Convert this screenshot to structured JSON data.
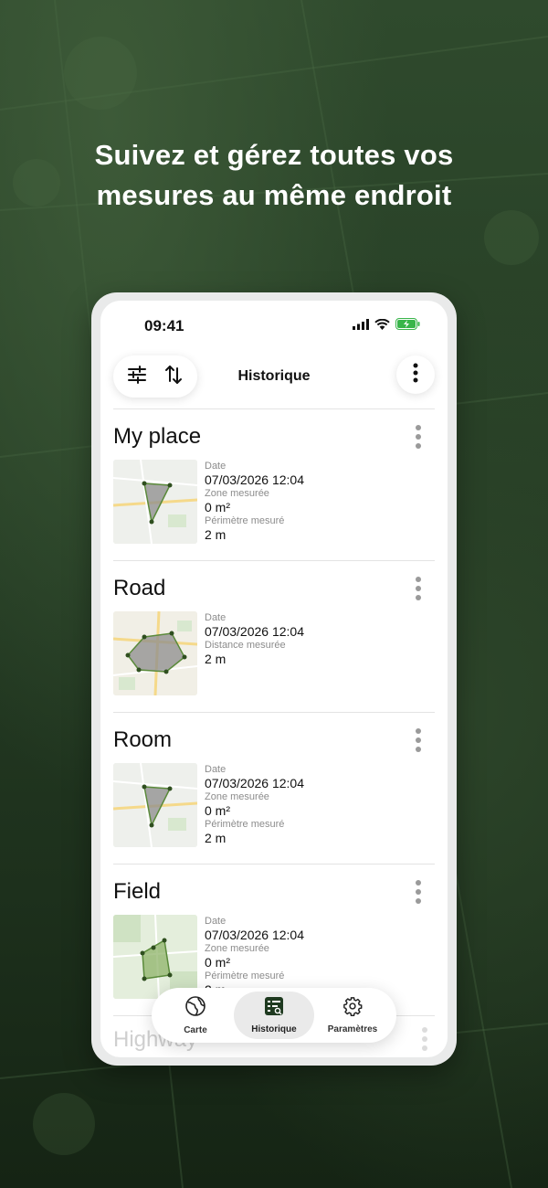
{
  "headline": [
    "Suivez et gérez toutes vos",
    "mesures au même endroit"
  ],
  "status_bar": {
    "time": "09:41",
    "icons": [
      "signal-icon",
      "wifi-icon",
      "battery-charging-icon"
    ]
  },
  "header": {
    "title": "Historique",
    "left_buttons": [
      "filter-sliders-icon",
      "sort-arrows-icon"
    ],
    "right_button": "more-vertical-icon"
  },
  "items": [
    {
      "name": "My place",
      "fields": [
        {
          "label": "Date",
          "value": "07/03/2026 12:04"
        },
        {
          "label": "Zone mesurée",
          "value": "0 m²"
        },
        {
          "label": "Périmètre mesuré",
          "value": "2 m"
        }
      ]
    },
    {
      "name": "Road",
      "fields": [
        {
          "label": "Date",
          "value": "07/03/2026 12:04"
        },
        {
          "label": "Distance mesurée",
          "value": "2 m"
        }
      ]
    },
    {
      "name": "Room",
      "fields": [
        {
          "label": "Date",
          "value": "07/03/2026 12:04"
        },
        {
          "label": "Zone mesurée",
          "value": "0 m²"
        },
        {
          "label": "Périmètre mesuré",
          "value": "2 m"
        }
      ]
    },
    {
      "name": "Field",
      "fields": [
        {
          "label": "Date",
          "value": "07/03/2026 12:04"
        },
        {
          "label": "Zone mesurée",
          "value": "0 m²"
        },
        {
          "label": "Périmètre mesuré",
          "value": "2 m"
        }
      ]
    },
    {
      "name": "Highway",
      "fields": []
    }
  ],
  "bottom_nav": [
    {
      "label": "Carte",
      "icon": "globe-icon",
      "active": false
    },
    {
      "label": "Historique",
      "icon": "history-list-icon",
      "active": true
    },
    {
      "label": "Paramètres",
      "icon": "gear-icon",
      "active": false
    }
  ],
  "colors": {
    "accent_green": "#5a8a3a",
    "polygon_fill": "#8c8c8c"
  }
}
